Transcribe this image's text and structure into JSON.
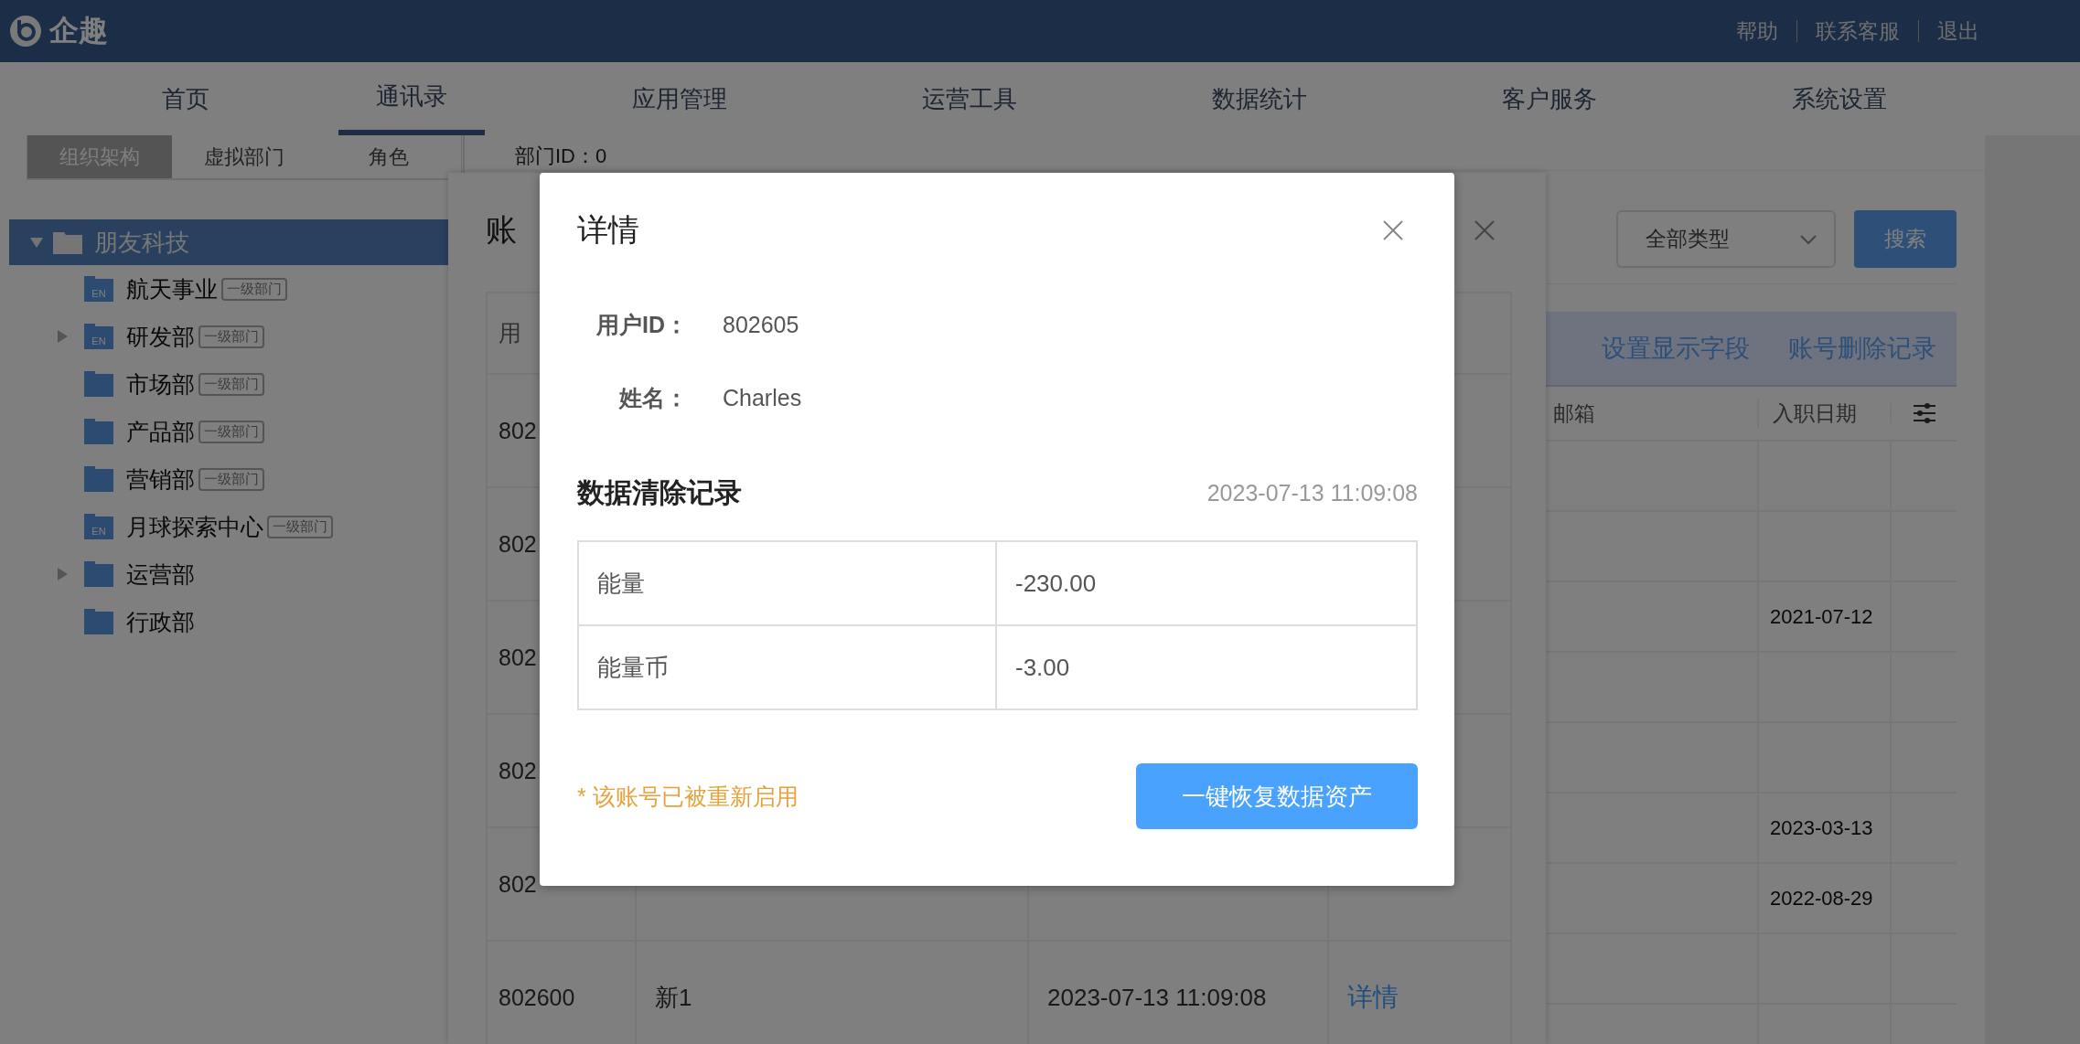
{
  "header": {
    "logo": "企趣",
    "links": [
      "帮助",
      "联系客服",
      "退出"
    ]
  },
  "nav": [
    {
      "label": "首页",
      "selected": false
    },
    {
      "label": "通讯录",
      "selected": true
    },
    {
      "label": "应用管理",
      "selected": false
    },
    {
      "label": "运营工具",
      "selected": false
    },
    {
      "label": "数据统计",
      "selected": false
    },
    {
      "label": "客户服务",
      "selected": false
    },
    {
      "label": "系统设置",
      "selected": false
    }
  ],
  "sidebar": {
    "tabs": [
      {
        "label": "组织架构",
        "selected": true
      },
      {
        "label": "虚拟部门",
        "selected": false
      },
      {
        "label": "角色",
        "selected": false
      }
    ],
    "tree": [
      {
        "label": "朋友科技",
        "selected": true,
        "has_children": true,
        "expanded": true,
        "children": [
          {
            "label": "航天事业",
            "kind": "en",
            "badge": "EN",
            "tag": "一级部门",
            "has_children": false,
            "selected": false
          },
          {
            "label": "研发部",
            "kind": "en",
            "badge": "EN",
            "tag": "一级部门",
            "has_children": true,
            "expanded": false,
            "selected": false
          },
          {
            "label": "市场部",
            "kind": "plain",
            "tag": "一级部门",
            "has_children": false,
            "selected": false
          },
          {
            "label": "产品部",
            "kind": "plain",
            "tag": "一级部门",
            "has_children": false,
            "selected": false
          },
          {
            "label": "营销部",
            "kind": "plain",
            "tag": "一级部门",
            "has_children": false,
            "selected": false
          },
          {
            "label": "月球探索中心",
            "kind": "en",
            "badge": "EN",
            "tag": "一级部门",
            "has_children": false,
            "selected": false
          },
          {
            "label": "运营部",
            "kind": "plain",
            "has_children": true,
            "expanded": false,
            "selected": false
          },
          {
            "label": "行政部",
            "kind": "plain",
            "has_children": false,
            "selected": false
          }
        ]
      }
    ]
  },
  "main": {
    "dept_id": "部门ID：0",
    "type_select": "全部类型",
    "search_button": "搜索",
    "toolbar_links": [
      "设置显示字段",
      "账号删除记录"
    ],
    "table": {
      "columns": [
        "邮箱",
        "入职日期"
      ],
      "rows": [
        {},
        {},
        {
          "date": "2021-07-12"
        },
        {},
        {},
        {
          "date": "2023-03-13"
        },
        {
          "date": "2022-08-29"
        },
        {},
        {}
      ]
    }
  },
  "records_dialog": {
    "title": "账",
    "columns": [
      "用"
    ],
    "rows": [
      {
        "id": "802"
      },
      {
        "id": "802"
      },
      {
        "id": "802"
      },
      {
        "id": "802"
      },
      {
        "id": "802"
      },
      {
        "id": "802600",
        "name": "新1",
        "time": "2023-07-13 11:09:08",
        "action": "详情"
      }
    ]
  },
  "detail_dialog": {
    "title": "详情",
    "fields": [
      {
        "label": "用户ID：",
        "value": "802605"
      },
      {
        "label": "姓名：",
        "value": "Charles"
      }
    ],
    "section_title": "数据清除记录",
    "timestamp": "2023-07-13 11:09:08",
    "records": [
      {
        "name": "能量",
        "value": "-230.00"
      },
      {
        "name": "能量币",
        "value": "-3.00"
      }
    ],
    "note": "* 该账号已被重新启用",
    "button": "一键恢复数据资产"
  }
}
